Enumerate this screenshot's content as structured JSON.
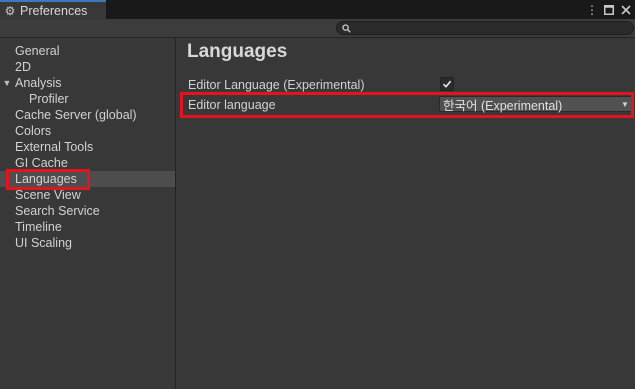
{
  "window": {
    "tab_title": "Preferences",
    "tab_icon": "gear-icon",
    "controls": [
      "more-options-icon",
      "maximize-icon",
      "close-icon"
    ]
  },
  "search": {
    "value": "",
    "placeholder": ""
  },
  "sidebar": {
    "items": [
      {
        "label": "General",
        "level": 0,
        "selected": false
      },
      {
        "label": "2D",
        "level": 0,
        "selected": false
      },
      {
        "label": "Analysis",
        "level": 0,
        "selected": false,
        "expanded": true
      },
      {
        "label": "Profiler",
        "level": 1,
        "selected": false
      },
      {
        "label": "Cache Server (global)",
        "level": 0,
        "selected": false
      },
      {
        "label": "Colors",
        "level": 0,
        "selected": false
      },
      {
        "label": "External Tools",
        "level": 0,
        "selected": false
      },
      {
        "label": "GI Cache",
        "level": 0,
        "selected": false
      },
      {
        "label": "Languages",
        "level": 0,
        "selected": true
      },
      {
        "label": "Scene View",
        "level": 0,
        "selected": false
      },
      {
        "label": "Search Service",
        "level": 0,
        "selected": false
      },
      {
        "label": "Timeline",
        "level": 0,
        "selected": false
      },
      {
        "label": "UI Scaling",
        "level": 0,
        "selected": false
      }
    ]
  },
  "main": {
    "title": "Languages",
    "fields": {
      "experimental": {
        "label": "Editor Language (Experimental)",
        "checked": true
      },
      "editor_language": {
        "label": "Editor language",
        "value": "한국어 (Experimental)"
      }
    }
  },
  "colors": {
    "background": "#383838",
    "selected_row": "#4d4d4d",
    "tab_accent": "#3a79bb",
    "highlight": "#e4141e"
  }
}
